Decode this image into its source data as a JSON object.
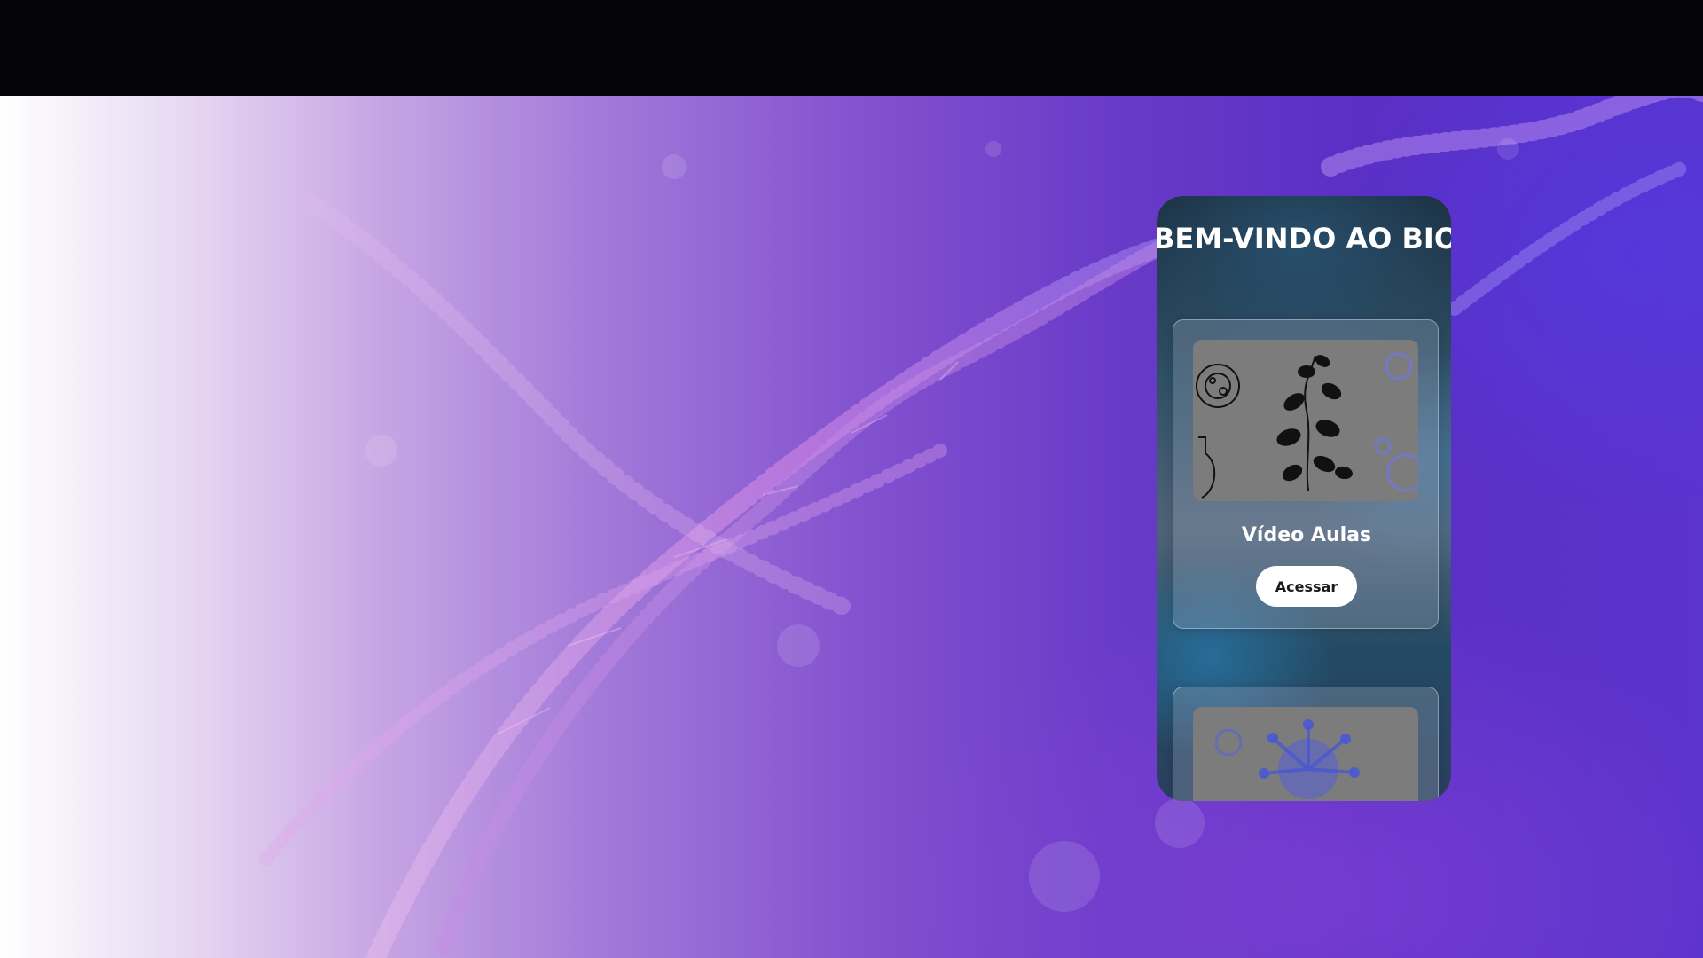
{
  "app": {
    "welcome_title": "BEM-VINDO AO BIOAPRENDER"
  },
  "cards": [
    {
      "title": "Vídeo Aulas",
      "button_label": "Acessar",
      "image_icon": "botany-illustration-icon"
    },
    {
      "image_icon": "virus-illustration-icon"
    }
  ],
  "colors": {
    "background_gradient_start": "#ffffff",
    "background_gradient_end": "#5b33cd",
    "top_bar": "#050408",
    "button_bg": "#ffffff",
    "card_image_bg": "#7c7c7c"
  }
}
